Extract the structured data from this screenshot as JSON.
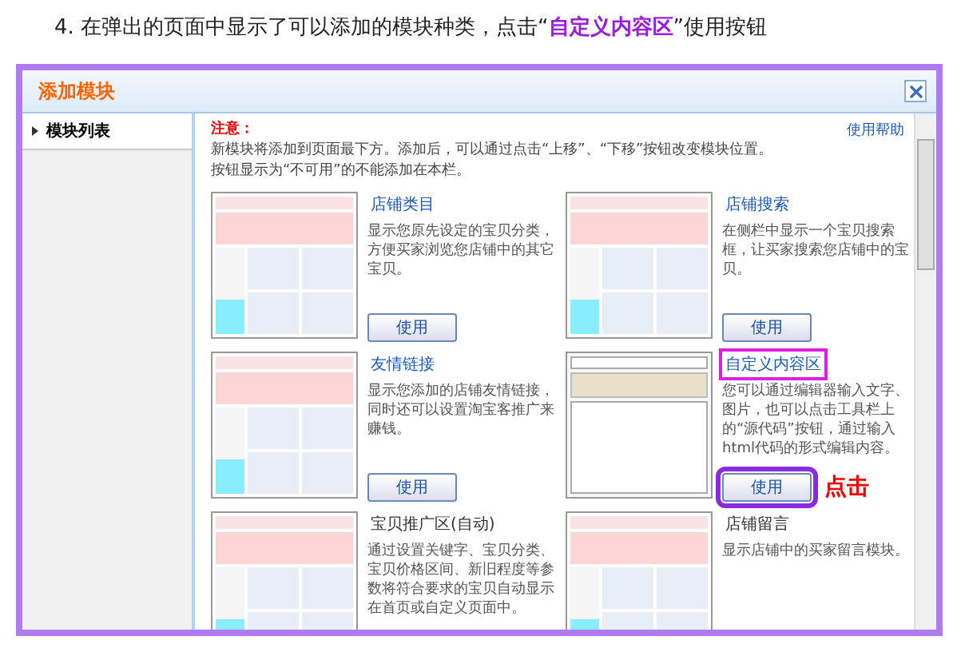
{
  "heading": {
    "prefix": "4. 在弹出的页面中显示了可以添加的模块种类，点击“",
    "highlight": "自定义内容区",
    "suffix": "”使用按钮"
  },
  "dialog": {
    "title": "添加模块",
    "sidebar": {
      "items": [
        {
          "label": "模块列表",
          "selected": true
        }
      ]
    },
    "notice": {
      "label": "注意：",
      "lines": [
        "新模块将添加到页面最下方。添加后，可以通过点击“上移”、“下移”按钮改变模块位置。",
        "按钮显示为“不可用”的不能添加在本栏。"
      ]
    },
    "help_link": "使用帮助",
    "modules": [
      {
        "kind": "shop",
        "title": "店铺类目",
        "link": true,
        "selected": false,
        "description": "显示您原先设定的宝贝分类，方便买家浏览您店铺中的其它宝贝。",
        "button": "使用"
      },
      {
        "kind": "shop",
        "title": "店铺搜索",
        "link": true,
        "selected": false,
        "description": "在侧栏中显示一个宝贝搜索框，让买家搜索您店铺中的宝贝。",
        "button": "使用"
      },
      {
        "kind": "shop",
        "title": "友情链接",
        "link": true,
        "selected": false,
        "description": "显示您添加的店铺友情链接，同时还可以设置淘宝客推广来赚钱。",
        "button": "使用"
      },
      {
        "kind": "editor",
        "title": "自定义内容区",
        "link": true,
        "selected": true,
        "description": "您可以通过编辑器输入文字、图片，也可以点击工具栏上的“源代码”按钮，通过输入html代码的形式编辑内容。",
        "button": "使用",
        "annotation": "点击"
      },
      {
        "kind": "shop",
        "title": "宝贝推广区(自动)",
        "link": false,
        "selected": false,
        "description": "通过设置关键字、宝贝分类、宝贝价格区间、新旧程度等参数将符合要求的宝贝自动显示在首页或自定义页面中。"
      },
      {
        "kind": "shop",
        "title": "店铺留言",
        "link": false,
        "selected": false,
        "description": "显示店铺中的买家留言模块。"
      }
    ]
  }
}
